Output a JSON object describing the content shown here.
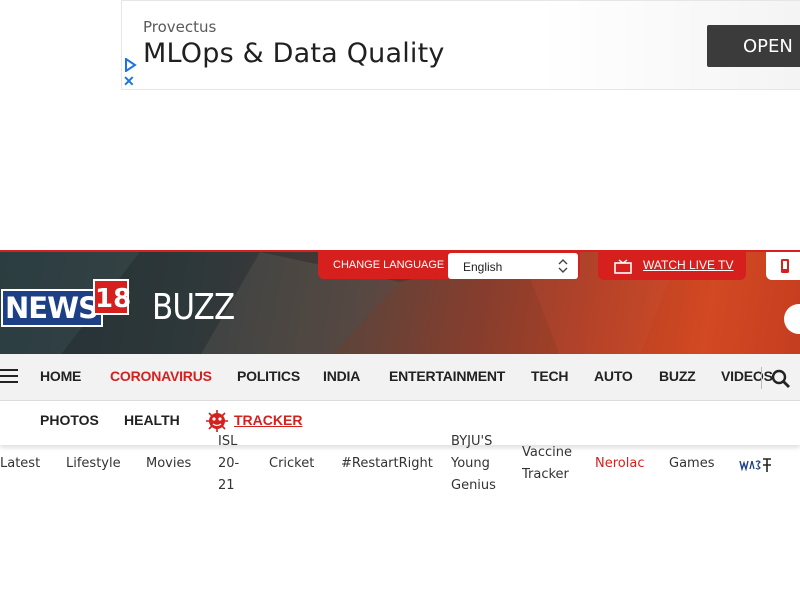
{
  "ad": {
    "advertiser": "Provectus",
    "headline": "MLOps & Data Quality",
    "cta": "OPEN",
    "close_glyph": "✕"
  },
  "header": {
    "logo_main": "NEWS",
    "logo_number": "18",
    "section_title": "BUZZ",
    "change_language_label": "CHANGE LANGUAGE",
    "language_selected": "English",
    "watch_live_label": "WATCH LIVE TV"
  },
  "nav": {
    "primary": [
      {
        "label": "HOME",
        "highlight": false
      },
      {
        "label": "CORONAVIRUS",
        "highlight": true
      },
      {
        "label": "POLITICS",
        "highlight": false
      },
      {
        "label": "INDIA",
        "highlight": false
      },
      {
        "label": "ENTERTAINMENT",
        "highlight": false
      },
      {
        "label": "TECH",
        "highlight": false
      },
      {
        "label": "AUTO",
        "highlight": false
      },
      {
        "label": "BUZZ",
        "highlight": false
      },
      {
        "label": "VIDEOS",
        "highlight": false
      }
    ],
    "secondary": [
      {
        "label": "PHOTOS"
      },
      {
        "label": "HEALTH"
      }
    ],
    "tracker_label": "TRACKER"
  },
  "sublinks": [
    {
      "label": "Latest"
    },
    {
      "label": "Lifestyle"
    },
    {
      "label": "Movies"
    },
    {
      "label": "ISL\n20-\n21"
    },
    {
      "label": "Cricket"
    },
    {
      "label": "#RestartRight"
    },
    {
      "label": "BYJU'S\nYoung\nGenius"
    },
    {
      "label": "Vaccine\nTracker"
    },
    {
      "label": "Nerolac",
      "highlight": true
    },
    {
      "label": "Games"
    }
  ],
  "colors": {
    "brand_red": "#d6201e",
    "brand_blue": "#1c3f86",
    "nav_bg": "#f2f2f2"
  }
}
